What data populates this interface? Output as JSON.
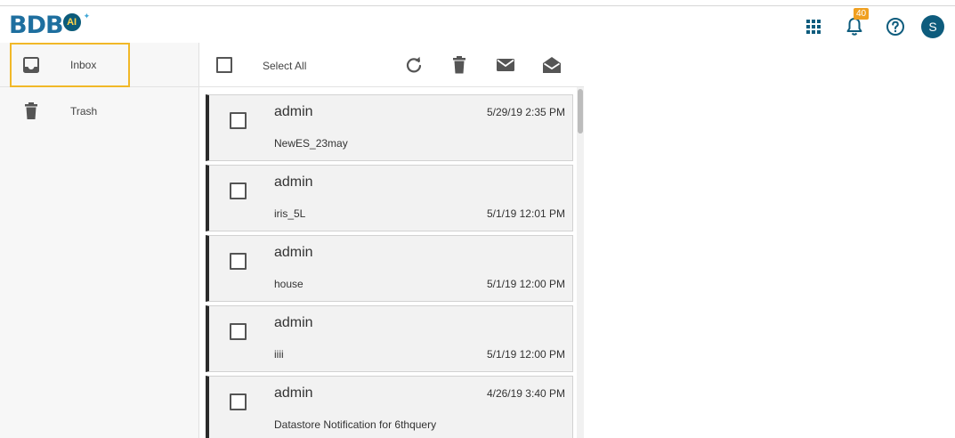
{
  "app": {
    "logo_text": "BDB",
    "logo_badge": "AI"
  },
  "topbar": {
    "apps_icon": "grid-apps-icon",
    "notifications_icon": "bell-icon",
    "notification_count": "40",
    "help_icon": "help-circle-icon",
    "user_initial": "S"
  },
  "sidebar": {
    "items": [
      {
        "label": "Inbox",
        "icon": "inbox-icon",
        "selected": true
      },
      {
        "label": "Trash",
        "icon": "trash-icon",
        "selected": false
      }
    ]
  },
  "toolbar": {
    "select_all_label": "Select All",
    "icons": [
      "refresh-icon",
      "delete-icon",
      "mark-unread-icon",
      "mark-read-icon"
    ]
  },
  "messages": [
    {
      "sender": "admin",
      "subject": "NewES_23may",
      "date": "5/29/19 2:35 PM",
      "date_position": "top"
    },
    {
      "sender": "admin",
      "subject": "iris_5L",
      "date": "5/1/19 12:01 PM",
      "date_position": "bottom"
    },
    {
      "sender": "admin",
      "subject": "house",
      "date": "5/1/19 12:00 PM",
      "date_position": "bottom"
    },
    {
      "sender": "admin",
      "subject": "iiii",
      "date": "5/1/19 12:00 PM",
      "date_position": "bottom"
    },
    {
      "sender": "admin",
      "subject": "Datastore Notification for 6thquery",
      "date": "4/26/19 3:40 PM",
      "date_position": "top"
    }
  ],
  "colors": {
    "accent_orange": "#f1b828",
    "brand_blue": "#0e5c7d",
    "card_border_left": "#2b2b2b",
    "badge": "#f0a020"
  }
}
